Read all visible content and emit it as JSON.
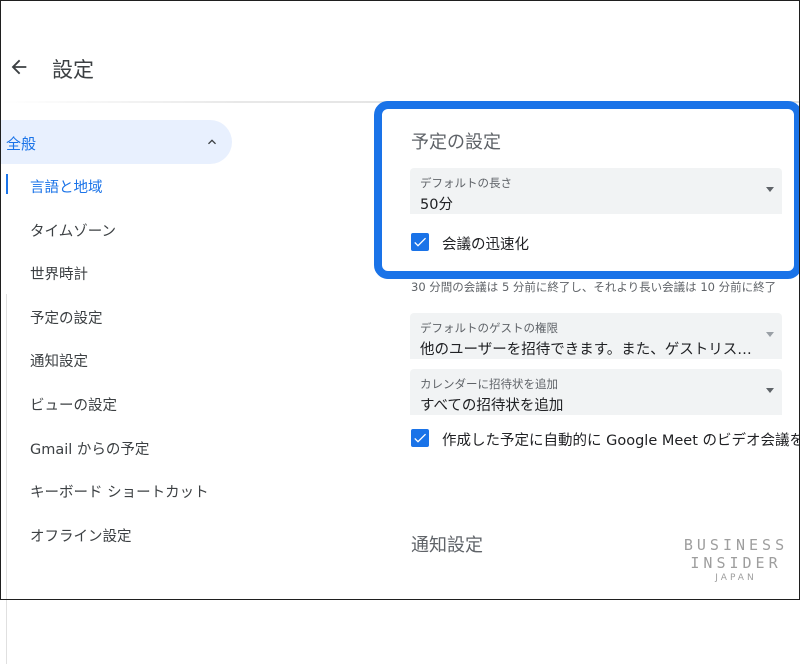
{
  "header": {
    "title": "設定",
    "back_icon": "arrow-left-icon"
  },
  "sidebar": {
    "section_label": "全般",
    "section_icon": "chevron-up-icon",
    "items": [
      {
        "label": "言語と地域",
        "active": true
      },
      {
        "label": "タイムゾーン"
      },
      {
        "label": "世界時計"
      },
      {
        "label": "予定の設定"
      },
      {
        "label": "通知設定"
      },
      {
        "label": "ビューの設定"
      },
      {
        "label": "Gmail からの予定"
      },
      {
        "label": "キーボード ショートカット"
      },
      {
        "label": "オフライン設定"
      }
    ]
  },
  "event_settings": {
    "title": "予定の設定",
    "default_duration": {
      "label": "デフォルトの長さ",
      "value": "50分"
    },
    "speedy_meetings": {
      "label": "会議の迅速化",
      "checked": true
    },
    "speedy_helper": "30 分間の会議は 5 分前に終了し、それより長い会議は 10 分前に終了",
    "guest_permissions": {
      "label": "デフォルトのゲストの権限",
      "value": "他のユーザーを招待できます。また、ゲストリス…"
    },
    "add_invitations": {
      "label": "カレンダーに招待状を追加",
      "value": "すべての招待状を追加"
    },
    "auto_meet": {
      "label": "作成した予定に自動的に Google Meet のビデオ会議を",
      "checked": true
    }
  },
  "notifications": {
    "title": "通知設定"
  },
  "watermark": {
    "line1": "BUSINESS",
    "line2": "INSIDER",
    "line3": "JAPAN"
  },
  "colors": {
    "accent": "#1a73e8",
    "highlight_border": "#1a73e8",
    "sidebar_active_bg": "#e8f0fe"
  }
}
